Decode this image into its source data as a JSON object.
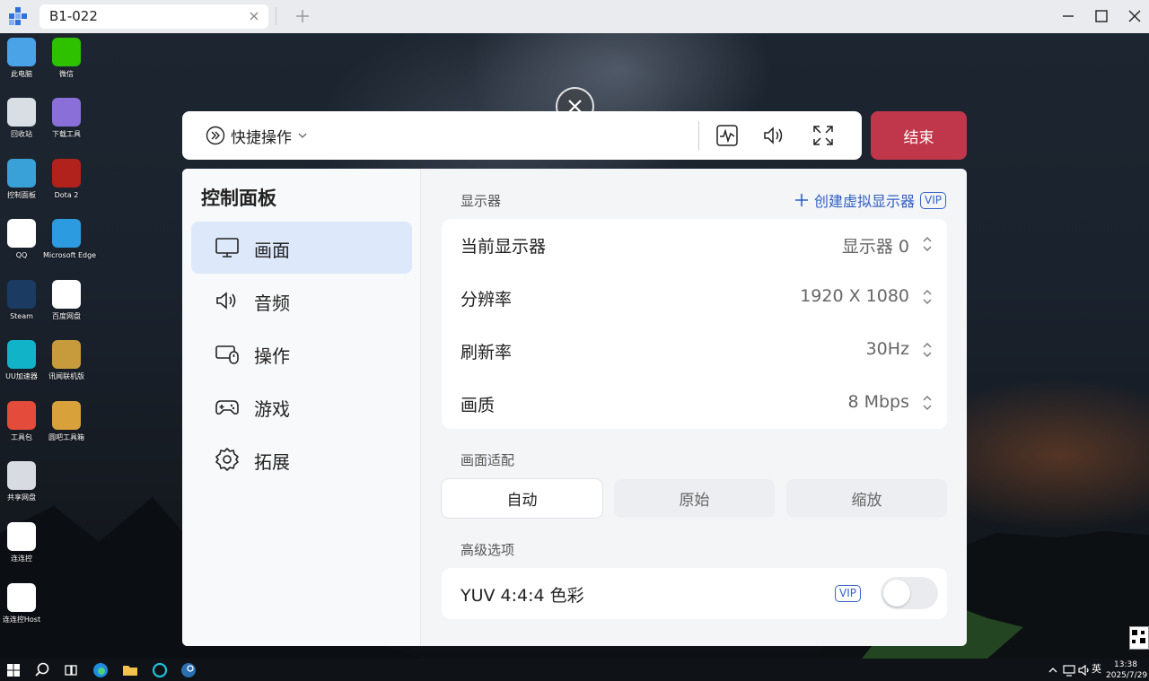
{
  "window": {
    "tab_title": "B1-022"
  },
  "desktop_icons": [
    {
      "label": "此电脑",
      "icon": "computer-icon",
      "color": "#4aa3e6"
    },
    {
      "label": "微信",
      "icon": "wechat-icon",
      "color": "#2dc100"
    },
    {
      "label": "回收站",
      "icon": "recycle-bin-icon",
      "color": "#d9dde4"
    },
    {
      "label": "下载工具",
      "icon": "download-tool-icon",
      "color": "#8a6fd8"
    },
    {
      "label": "控制面板",
      "icon": "control-panel-icon",
      "color": "#3aa0d8"
    },
    {
      "label": "Dota 2",
      "icon": "dota2-icon",
      "color": "#b0221b"
    },
    {
      "label": "QQ",
      "icon": "qq-icon",
      "color": "#ffffff"
    },
    {
      "label": "Microsoft Edge",
      "icon": "edge-icon",
      "color": "#2c9be0"
    },
    {
      "label": "Steam",
      "icon": "steam-icon",
      "color": "#1b3b63"
    },
    {
      "label": "百度网盘",
      "icon": "baidu-netdisk-icon",
      "color": "#ffffff"
    },
    {
      "label": "UU加速器",
      "icon": "uu-accelerator-icon",
      "color": "#10b3c8"
    },
    {
      "label": "讯闻联机版",
      "icon": "game-icon",
      "color": "#c79a3c"
    },
    {
      "label": "工具包",
      "icon": "toolkit-icon",
      "color": "#e44b3a"
    },
    {
      "label": "圆吧工具箱",
      "icon": "toolbox-icon",
      "color": "#d8a13a"
    },
    {
      "label": "共享网盘",
      "icon": "shared-disk-icon",
      "color": "#d8dbe2"
    },
    {
      "label": "连连控",
      "icon": "lianliankong-icon",
      "color": "#ffffff"
    },
    {
      "label": "连连控Host",
      "icon": "lianliankong-host-icon",
      "color": "#ffffff"
    }
  ],
  "toolbar": {
    "quick_label": "快捷操作",
    "end_label": "结束",
    "icons": [
      "monitor-stats-icon",
      "volume-icon",
      "fullscreen-icon"
    ]
  },
  "panel": {
    "title": "控制面板",
    "menu": [
      {
        "label": "画面",
        "icon": "display-icon",
        "active": true
      },
      {
        "label": "音频",
        "icon": "audio-icon",
        "active": false
      },
      {
        "label": "操作",
        "icon": "input-icon",
        "active": false
      },
      {
        "label": "游戏",
        "icon": "gamepad-icon",
        "active": false
      },
      {
        "label": "拓展",
        "icon": "settings-icon",
        "active": false
      }
    ],
    "display_section": "显示器",
    "create_virtual": "创建虚拟显示器",
    "vip": "VIP",
    "settings": [
      {
        "label": "当前显示器",
        "value": "显示器 0"
      },
      {
        "label": "分辨率",
        "value": "1920 X 1080"
      },
      {
        "label": "刷新率",
        "value": "30Hz"
      },
      {
        "label": "画质",
        "value": "8 Mbps"
      }
    ],
    "fit_section": "画面适配",
    "fit_options": [
      "自动",
      "原始",
      "缩放"
    ],
    "fit_selected": "自动",
    "advanced_section": "高级选项",
    "yuv_label": "YUV 4:4:4 色彩",
    "yuv_enabled": false
  },
  "taskbar": {
    "ime": "英",
    "time": "13:38",
    "date": "2025/7/29"
  },
  "colors": {
    "accent": "#2f5fc4",
    "end_button": "#c0364a",
    "active_menu": "#dde8fb"
  }
}
